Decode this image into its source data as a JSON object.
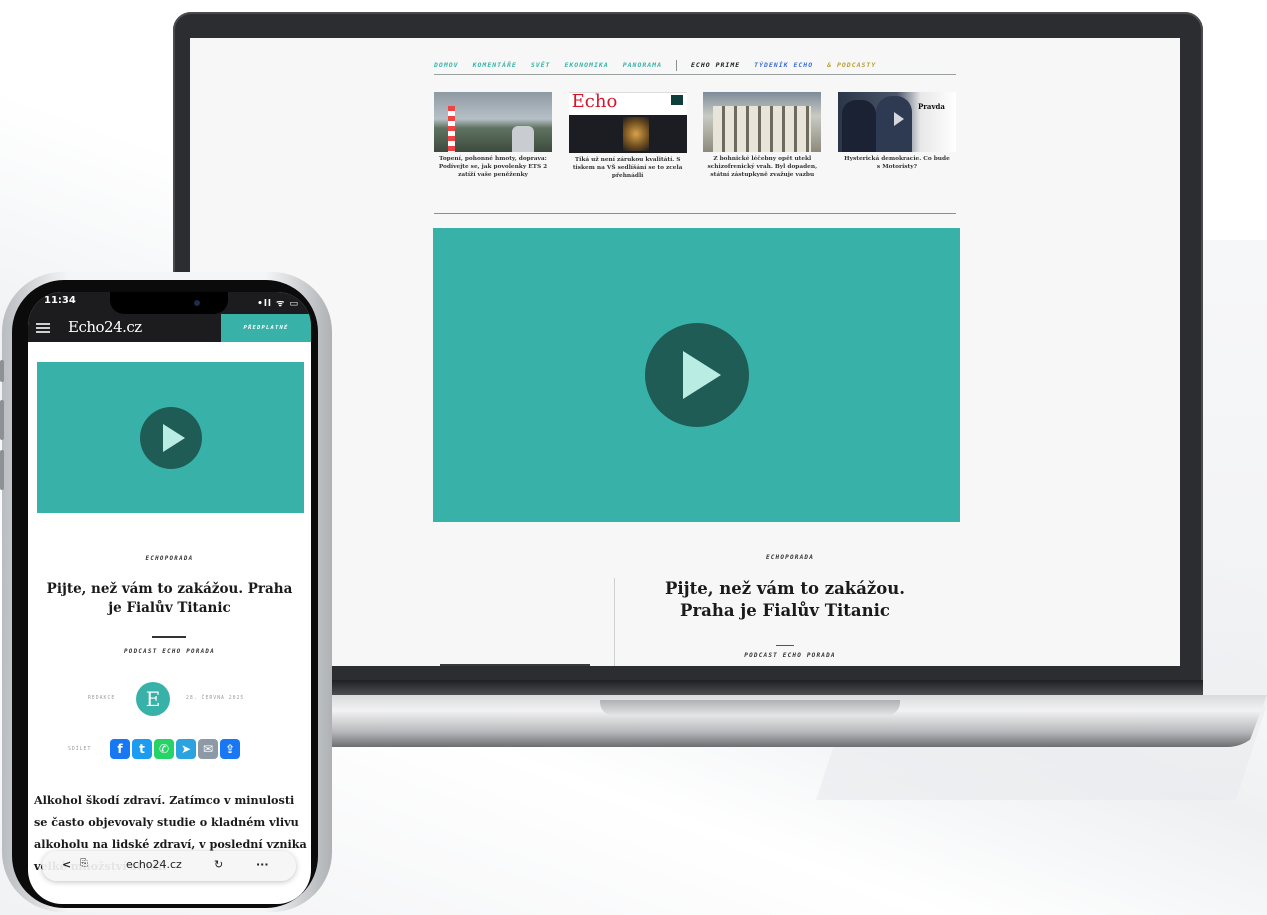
{
  "laptop": {
    "nav": {
      "items": [
        "DOMOV",
        "KOMENTÁŘE",
        "SVĚT",
        "EKONOMIKA",
        "PANORAMA"
      ],
      "prime": "ECHO PRIME",
      "tydenik": "TÝDENÍK ECHO",
      "podcasty": "& PODCASTY"
    },
    "thumbnails": [
      {
        "caption": "Topení, pohonné hmoty, doprava: Podívejte se, jak povolenky ETS 2 zatíží vaše peněženky"
      },
      {
        "caption": "Tiká už není zárukou kvalitátí. S tiskem na VŠ sedlíšání se to zcela přehnádlí",
        "logo": "Echo"
      },
      {
        "caption": "Z bohnické léčebny opět utekl schizofrenický vrah. Byl dopaden, státní zástupkyně zvažuje vazbu"
      },
      {
        "caption": "Hysterická demokracie. Co bude s Motoristy?",
        "logo": "Pravda"
      }
    ],
    "article": {
      "kicker": "ECHOPORADA",
      "headline_line1": "Pijte, než vám to zakážou.",
      "headline_line2": "Praha je Fialův Titanic",
      "subkicker": "PODCAST ECHO PORADA"
    }
  },
  "phone": {
    "status": {
      "time": "11:34",
      "icons": "•ll ᯤ ▭"
    },
    "header": {
      "logo": "Echo24.cz",
      "subscribe": "PŘEDPLATNÉ"
    },
    "article": {
      "kicker": "ECHOPORADA",
      "headline": "Pijte, než vám to zakážou. Praha je Fialův Titanic",
      "subkicker": "PODCAST ECHO PORADA",
      "author_label": "REDAKCE",
      "avatar_letter": "E",
      "date": "28. ČERVNA 2025",
      "share_label": "SDÍLET",
      "body": "Alkohol škodí zdraví. Zatímco v minulosti se často objevovaly studie o kladném vlivu alkoholu na lidské zdraví, v poslední vznika velké množství studií"
    },
    "urlbar": {
      "back": "<",
      "url": "echo24.cz",
      "reload": "↻",
      "more": "···"
    }
  },
  "colors": {
    "accent": "#38b2a8",
    "play": "#1f5c55",
    "dark": "#1c1c1e"
  }
}
